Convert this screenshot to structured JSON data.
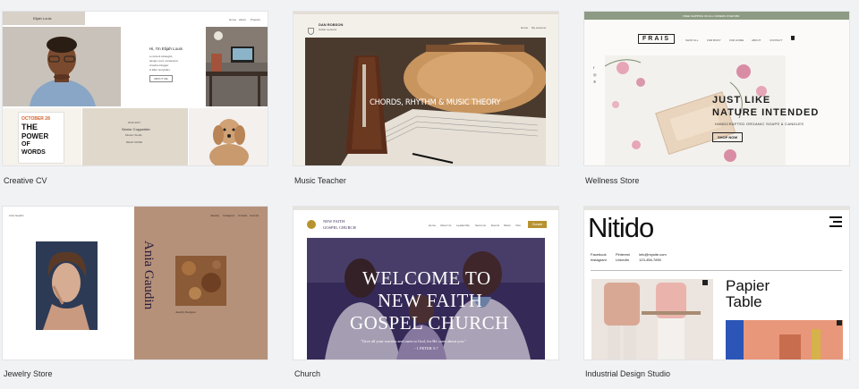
{
  "templates": [
    {
      "caption": "Creative CV",
      "site": {
        "name": "Elijah Louis",
        "nav": [
          "Home",
          "About",
          "Projects"
        ],
        "heading": "Hi, I'm Elijah Louis",
        "intro": [
          "a content strategist,",
          "design nerd, occasional",
          "creative blogger",
          "& killer storyteller."
        ],
        "cta": "ABOUT ME",
        "poster": [
          "OCTOBER 28",
          "THE",
          "POWER",
          "OF",
          "WORDS"
        ],
        "job_date": "2016-2017",
        "job_title": "Senior Copywriter",
        "job_place": "Mosaic Studio",
        "job_cta": "READ MORE"
      }
    },
    {
      "caption": "Music Teacher",
      "site": {
        "name": "DAN ROBSON",
        "subtitle": "Guitar Lessons",
        "nav": [
          "Home",
          "My Lessons"
        ],
        "hero": "CHORDS, RHYTHM & MUSIC THEORY"
      }
    },
    {
      "caption": "Wellness Store",
      "site": {
        "banner": "FREE SHIPPING ON ALL ORDERS OVER $50",
        "logo": "FRAIS",
        "nav": [
          "SHOP ALL",
          "FOR BODY",
          "FOR HOME",
          "ABOUT",
          "CONTACT"
        ],
        "headline": [
          "JUST LIKE",
          "NATURE INTENDED"
        ],
        "tagline": "HANDCRAFTED ORGANIC SOAPS & CANDLES",
        "cta": "SHOP NOW",
        "social": [
          "f",
          "◎",
          "℗"
        ]
      }
    },
    {
      "caption": "Jewelry Store",
      "site": {
        "name": "Ania Gaudin",
        "nav": [
          "Jewelry",
          "Instagram",
          "Contact",
          "Cart (0)"
        ],
        "title": "Ania Gaudin",
        "subtitle": "Jewelry Designer"
      }
    },
    {
      "caption": "Church",
      "site": {
        "name": [
          "NEW FAITH",
          "GOSPEL CHURCH"
        ],
        "nav": [
          "Home",
          "About Us",
          "Leadership",
          "Sermons",
          "Events",
          "Music",
          "Visit"
        ],
        "donate": "Donate",
        "hero": [
          "WELCOME TO",
          "NEW FAITH",
          "GOSPEL CHURCH"
        ],
        "verse": "\"Give all your worries and cares to God, for He cares about you.\"",
        "verse_ref": "- 1 PETER 5:7"
      }
    },
    {
      "caption": "Industrial Design Studio",
      "site": {
        "logo": "Nitido",
        "contact": [
          [
            "Facebook",
            "Pinterest",
            "info@mysite.com"
          ],
          [
            "Instagram",
            "LinkedIn",
            "123-456-7890"
          ]
        ],
        "project": [
          "Papier",
          "Table"
        ]
      }
    }
  ]
}
